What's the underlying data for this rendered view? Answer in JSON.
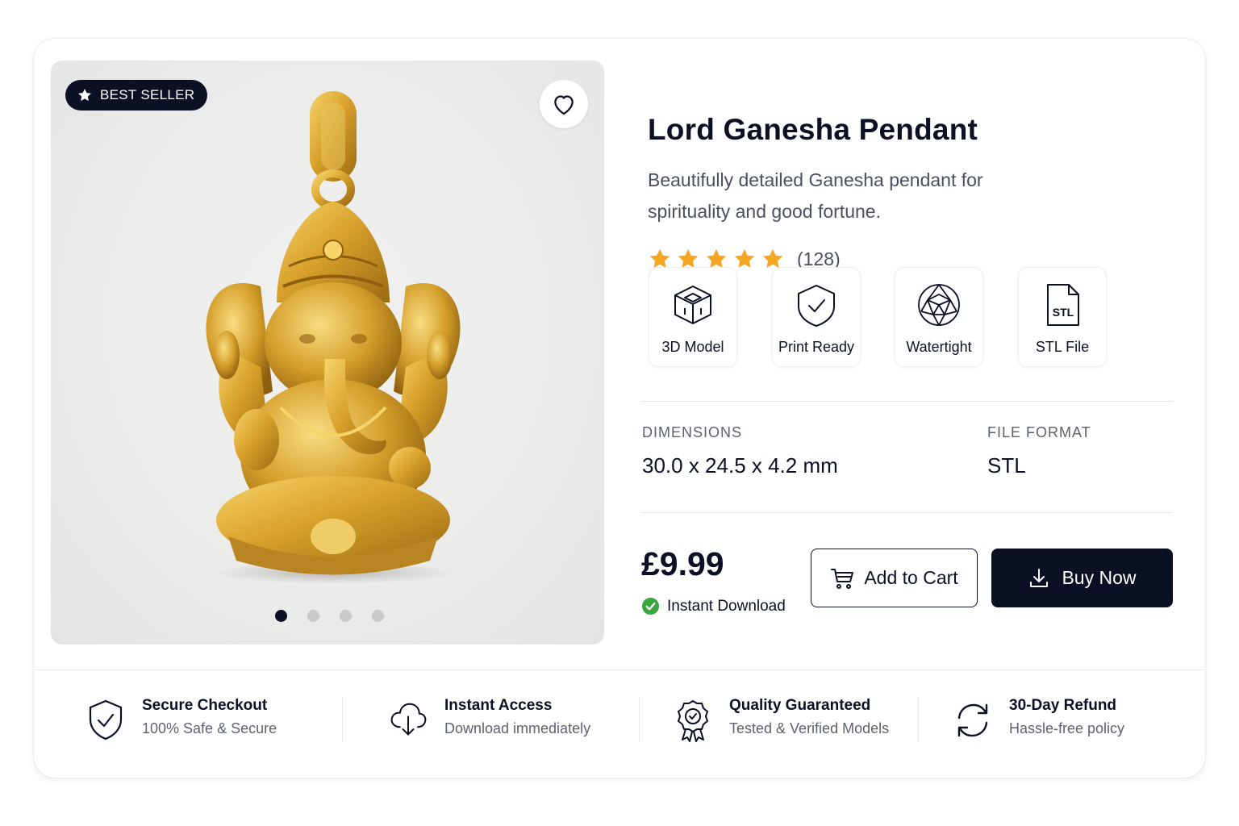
{
  "gallery": {
    "badge_label": "BEST SELLER",
    "active_slide": 1,
    "slide_count": 4
  },
  "product": {
    "title": "Lord Ganesha Pendant",
    "description": "Beautifully detailed Ganesha pendant for spirituality and good fortune.",
    "rating_stars": 5,
    "rating_count": "(128)"
  },
  "features": [
    {
      "label": "3D Model",
      "icon": "cube-icon"
    },
    {
      "label": "Print Ready",
      "icon": "shield-check-icon"
    },
    {
      "label": "Watertight",
      "icon": "geodesic-sphere-icon"
    },
    {
      "label": "STL File",
      "icon": "stl-file-icon",
      "icon_text": "STL"
    }
  ],
  "specs": {
    "dimensions_label": "DIMENSIONS",
    "dimensions_value": "30.0 x 24.5 x 4.2 mm",
    "format_label": "FILE FORMAT",
    "format_value": "STL"
  },
  "purchase": {
    "price": "£9.99",
    "instant_label": "Instant Download",
    "add_to_cart_label": "Add to Cart",
    "buy_now_label": "Buy Now"
  },
  "trust": [
    {
      "title": "Secure Checkout",
      "subtitle": "100% Safe & Secure",
      "icon": "shield-check-icon"
    },
    {
      "title": "Instant Access",
      "subtitle": "Download immediately",
      "icon": "cloud-download-icon"
    },
    {
      "title": "Quality Guaranteed",
      "subtitle": "Tested & Verified Models",
      "icon": "award-badge-icon"
    },
    {
      "title": "30-Day Refund",
      "subtitle": "Hassle-free policy",
      "icon": "refresh-icon"
    }
  ],
  "colors": {
    "primary": "#0b1024",
    "star": "#f5a623",
    "success": "#3aa63f",
    "gold": "#d4a22c"
  }
}
